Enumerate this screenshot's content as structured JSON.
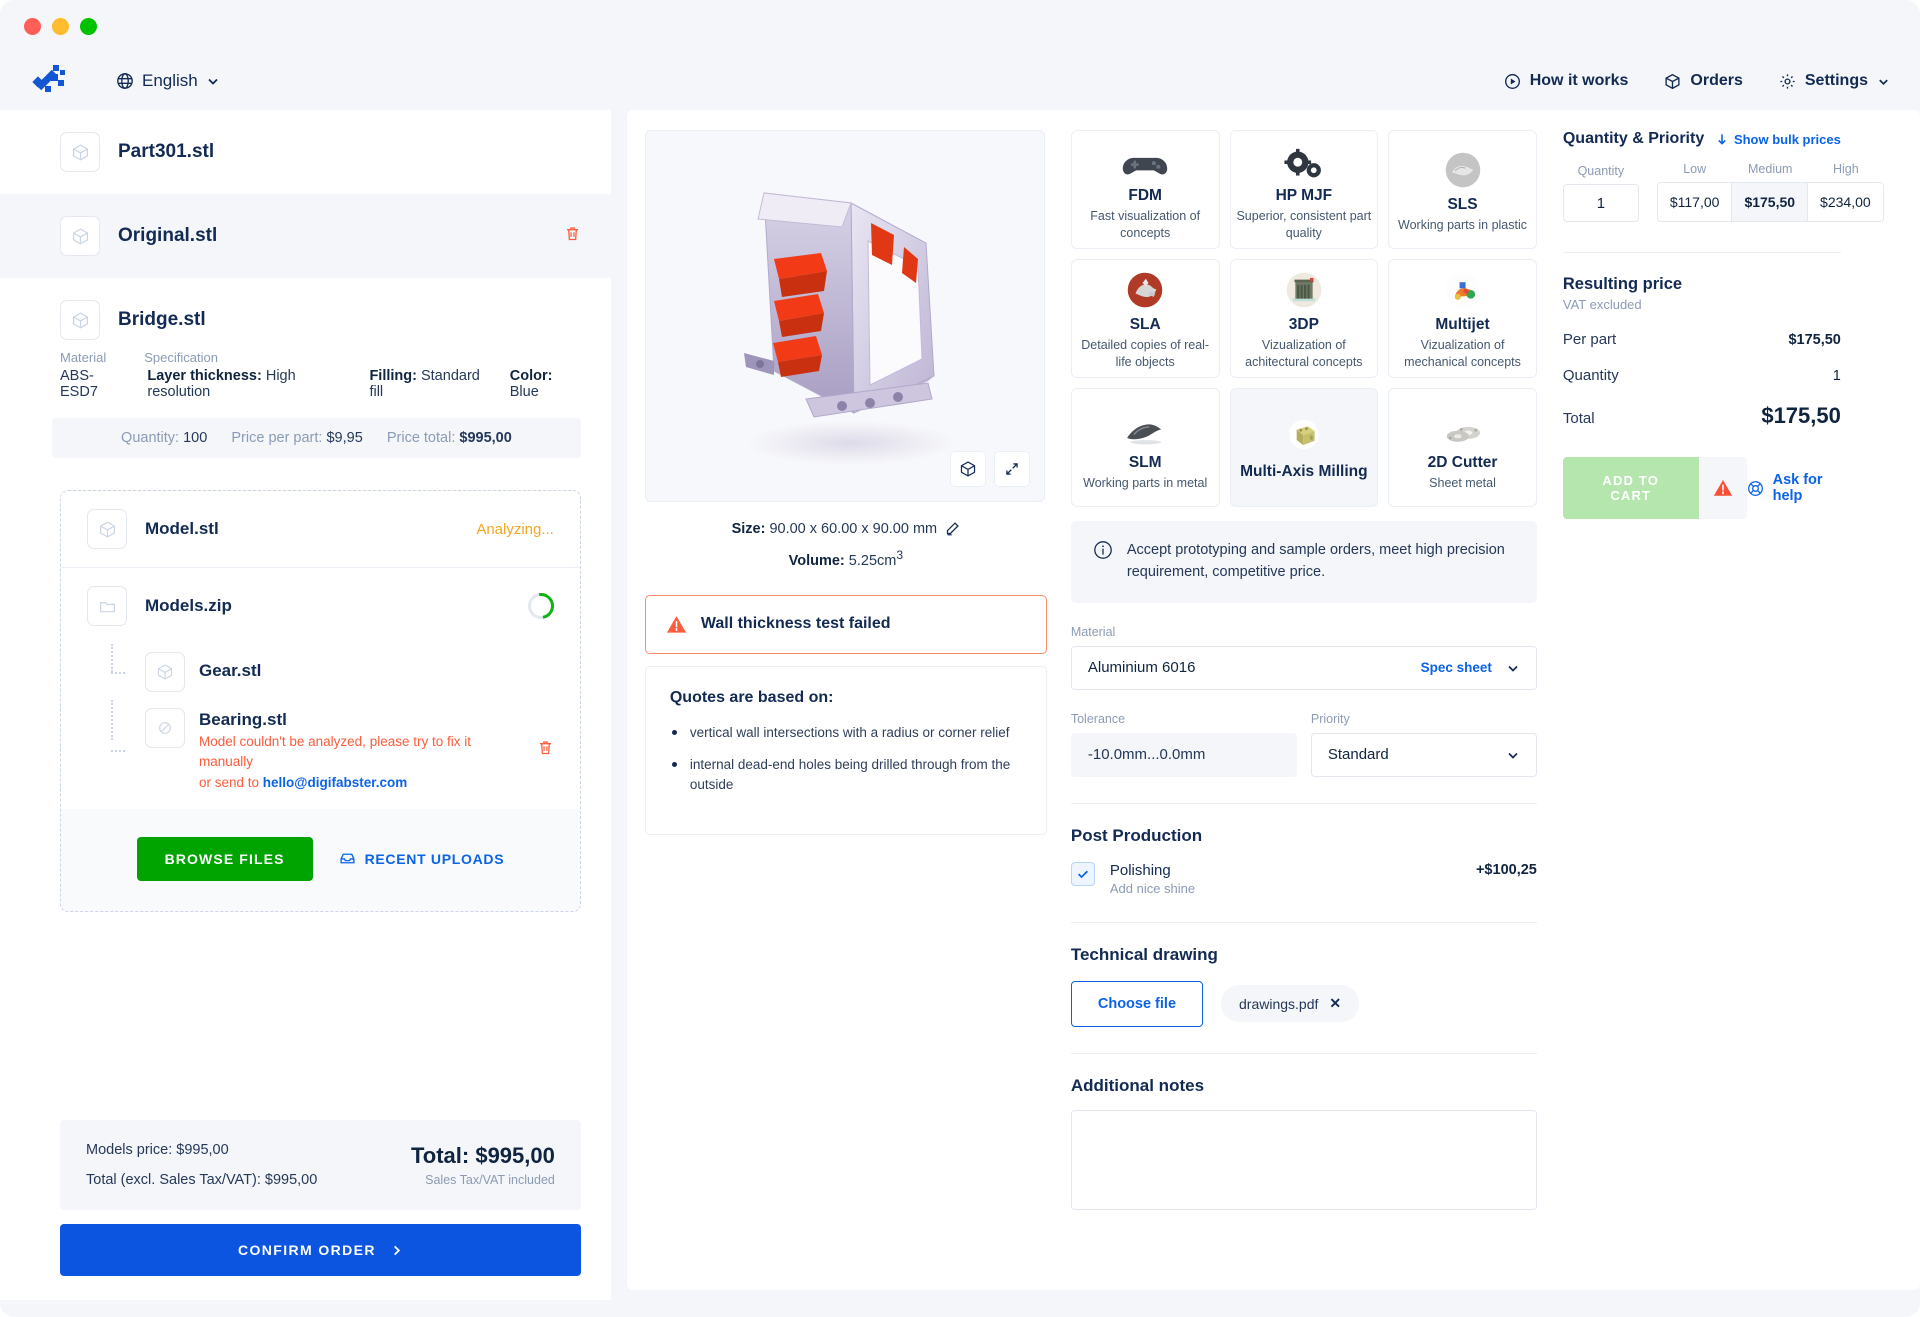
{
  "window": {
    "dots": [
      "close",
      "minimize",
      "maximize"
    ]
  },
  "topnav": {
    "language": "English",
    "items": [
      {
        "label": "How it works",
        "icon": "play-circle-icon"
      },
      {
        "label": "Orders",
        "icon": "box-icon"
      },
      {
        "label": "Settings",
        "icon": "gear-icon"
      }
    ]
  },
  "files": [
    {
      "name": "Part301.stl",
      "icon": "model-icon",
      "selected": false,
      "deletable": false
    },
    {
      "name": "Original.stl",
      "icon": "model-icon",
      "selected": true,
      "deletable": true
    },
    {
      "name": "Bridge.stl",
      "icon": "model-icon",
      "selected": false,
      "deletable": false
    }
  ],
  "bridge_spec": {
    "head_material": "Material",
    "head_specification": "Specification",
    "material": "ABS-ESD7",
    "layer_label": "Layer thickness:",
    "layer_value": "High resolution",
    "filling_label": "Filling:",
    "filling_value": "Standard fill",
    "color_label": "Color:",
    "color_value": "Blue",
    "quantity_label": "Quantity:",
    "quantity_value": "100",
    "per_part_label": "Price per part:",
    "per_part_value": "$9,95",
    "total_label": "Price total:",
    "total_value": "$995,00"
  },
  "upload": {
    "rows": [
      {
        "name": "Model.stl",
        "icon": "model-icon",
        "status": "Analyzing...",
        "state": "analyzing"
      },
      {
        "name": "Models.zip",
        "icon": "folder-icon",
        "status": "",
        "state": "loading"
      }
    ],
    "children": [
      {
        "name": "Gear.stl",
        "icon": "model-icon",
        "error": "",
        "error2": "",
        "link": "",
        "deletable": false
      },
      {
        "name": "Bearing.stl",
        "icon": "blocked-icon",
        "error": "Model couldn't be analyzed, please try to fix it manually",
        "error2": "or send to ",
        "link": "hello@digifabster.com",
        "deletable": true
      }
    ],
    "browse_label": "BROWSE FILES",
    "recent_label": "RECENT UPLOADS"
  },
  "left_footer": {
    "models_price": "Models price: $995,00",
    "total_excl": "Total (excl. Sales Tax/VAT): $995,00",
    "grand_label": "Total:",
    "grand_value": "$995,00",
    "grand_sub": "Sales Tax/VAT included",
    "confirm_label": "CONFIRM ORDER"
  },
  "viewer": {
    "size_label": "Size:",
    "size_value": "90.00 x 60.00 x 90.00 mm",
    "volume_label": "Volume:",
    "volume_value": "5.25cm",
    "volume_sup": "3",
    "buttons": [
      "box-view-icon",
      "expand-icon"
    ],
    "edit_icon": "pencil-icon"
  },
  "alert": {
    "text": "Wall thickness test failed",
    "icon": "warning-triangle-icon"
  },
  "quotes": {
    "title": "Quotes are based on:",
    "items": [
      "vertical wall intersections with a radius or corner relief",
      "internal dead-end holes being drilled through from the outside"
    ]
  },
  "technologies": [
    {
      "name": "FDM",
      "desc": "Fast visualization of concepts",
      "selected": false,
      "icon": "gamepad-icon"
    },
    {
      "name": "HP MJF",
      "desc": "Superior, consistent part quality",
      "selected": false,
      "icon": "gears-icon"
    },
    {
      "name": "SLS",
      "desc": "Working parts in plastic",
      "selected": false,
      "icon": "sls-part-icon"
    },
    {
      "name": "SLA",
      "desc": "Detailed copies of real-life objects",
      "selected": false,
      "icon": "sla-part-icon"
    },
    {
      "name": "3DP",
      "desc": "Vizualization of achitectural concepts",
      "selected": false,
      "icon": "building-icon"
    },
    {
      "name": "Multijet",
      "desc": "Vizualization of mechanical concepts",
      "selected": false,
      "icon": "multijet-icon"
    },
    {
      "name": "SLM",
      "desc": "Working parts in metal",
      "selected": false,
      "icon": "slm-part-icon"
    },
    {
      "name": "Multi-Axis Milling",
      "desc": "",
      "selected": true,
      "icon": "milled-block-icon"
    },
    {
      "name": "2D Cutter",
      "desc": "Sheet metal",
      "selected": false,
      "icon": "sheet-metal-icon"
    }
  ],
  "info_note": {
    "icon": "info-circle-icon",
    "text": "Accept prototyping and sample orders, meet high precision requirement, competitive price."
  },
  "form": {
    "material_label": "Material",
    "material_value": "Aluminium 6016",
    "spec_sheet": "Spec sheet",
    "tolerance_label": "Tolerance",
    "tolerance_value": "-10.0mm...0.0mm",
    "priority_label": "Priority",
    "priority_value": "Standard"
  },
  "post_production": {
    "title": "Post Production",
    "options": [
      {
        "name": "Polishing",
        "sub": "Add nice shine",
        "price": "+$100,25",
        "checked": true
      }
    ]
  },
  "technical_drawing": {
    "title": "Technical drawing",
    "choose_label": "Choose file",
    "file": "drawings.pdf"
  },
  "additional_notes": {
    "title": "Additional notes",
    "value": ""
  },
  "pricing": {
    "title": "Quantity & Priority",
    "bulk_label": "Show bulk prices",
    "quantity_header": "Quantity",
    "quantity_value": "1",
    "tiers": [
      {
        "label": "Low",
        "price": "$117,00",
        "active": false
      },
      {
        "label": "Medium",
        "price": "$175,50",
        "active": true
      },
      {
        "label": "High",
        "price": "$234,00",
        "active": false
      }
    ],
    "resulting_title": "Resulting price",
    "vat_note": "VAT excluded",
    "rows": [
      {
        "label": "Per part",
        "value": "$175,50"
      },
      {
        "label": "Quantity",
        "value": "1"
      }
    ],
    "total_label": "Total",
    "total_value": "$175,50",
    "cart_label": "ADD TO CART",
    "help_label": "Ask for help"
  },
  "colors": {
    "brand_blue": "#0b55e0",
    "link_blue": "#0b63e5",
    "dark_navy": "#132a53",
    "green": "#00a400",
    "warn_red": "#fa5c3c",
    "amber": "#f5a623",
    "bg_gray": "#f4f6fa"
  }
}
